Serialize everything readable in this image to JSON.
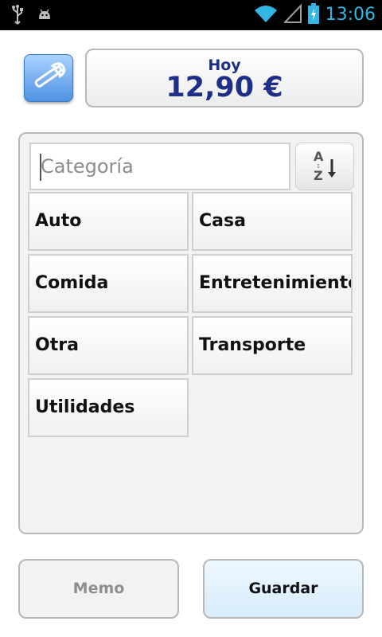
{
  "status_bar": {
    "time": "13:06",
    "icons": [
      "usb-icon",
      "android-debug-icon",
      "wifi-icon",
      "signal-icon",
      "battery-charging-icon"
    ]
  },
  "header": {
    "settings_icon": "wrench-icon",
    "today_label": "Hoy",
    "today_amount": "12,90 €"
  },
  "category_panel": {
    "search_placeholder": "Categoría",
    "sort_icon": "sort-az-icon",
    "categories": [
      "Auto",
      "Casa",
      "Comida",
      "Entretenimiento",
      "Otra",
      "Transporte",
      "Utilidades"
    ]
  },
  "footer": {
    "memo_label": "Memo",
    "save_label": "Guardar"
  },
  "colors": {
    "accent_blue": "#1d2f86",
    "statusbar_icon": "#33b5e5",
    "settings_button": "#4f92e4",
    "save_button_bg": "#d7ecfb"
  }
}
